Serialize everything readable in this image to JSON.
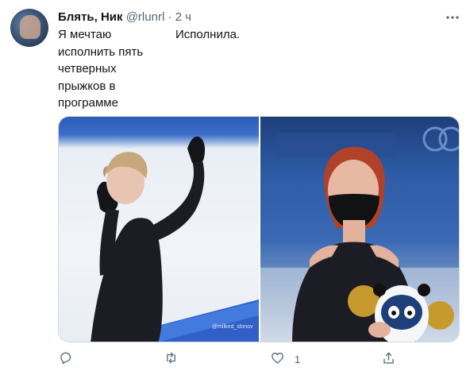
{
  "tweet": {
    "author_name": "Блять, Ник",
    "handle": "@rlunrl",
    "separator": " · ",
    "time": "2 ч",
    "text_left": "Я мечтаю исполнить пять четверных прыжков в программе",
    "text_right": "Исполнила.",
    "media": {
      "left_image_icon": "figure-skater-photo",
      "left_watermark": "@milked_slonov",
      "right_image_icon": "skater-with-mascot-photo"
    },
    "actions": {
      "reply_icon": "reply-icon",
      "retweet_icon": "retweet-icon",
      "like_icon": "like-icon",
      "like_count": "1",
      "share_icon": "share-icon"
    },
    "more_icon": "more-icon"
  },
  "colors": {
    "text": "#0f1419",
    "secondary": "#536471",
    "border": "#cfd9de"
  }
}
